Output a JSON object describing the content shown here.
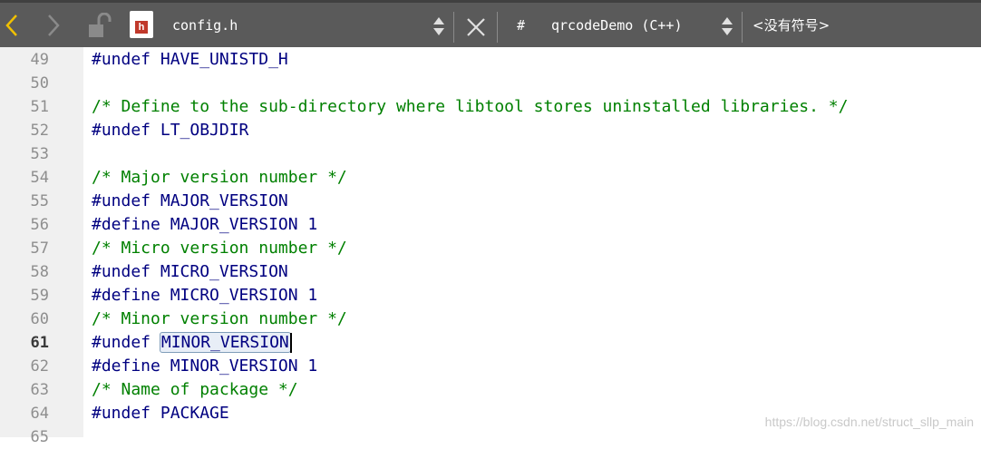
{
  "toolbar": {
    "file_name": "config.h",
    "hash_label": "#",
    "scope_name": "qrcodeDemo (C++)",
    "symbol_label": "<没有符号>",
    "icons": [
      "back-arrow-icon",
      "forward-arrow-icon",
      "unlock-icon",
      "header-file-icon",
      "updown-arrows-icon",
      "close-icon"
    ],
    "accent": "#f0c000"
  },
  "editor": {
    "current_line": "61",
    "lines": [
      {
        "no": "49",
        "kind": "directive",
        "text": "#undef HAVE_UNISTD_H"
      },
      {
        "no": "50",
        "kind": "blank",
        "text": ""
      },
      {
        "no": "51",
        "kind": "comment",
        "text": "/* Define to the sub-directory where libtool stores uninstalled libraries. */"
      },
      {
        "no": "52",
        "kind": "directive",
        "text": "#undef LT_OBJDIR"
      },
      {
        "no": "53",
        "kind": "blank",
        "text": ""
      },
      {
        "no": "54",
        "kind": "comment",
        "text": "/* Major version number */"
      },
      {
        "no": "55",
        "kind": "directive",
        "text": "#undef MAJOR_VERSION"
      },
      {
        "no": "56",
        "kind": "directive",
        "text": "#define MAJOR_VERSION 1"
      },
      {
        "no": "57",
        "kind": "comment",
        "text": "/* Micro version number */"
      },
      {
        "no": "58",
        "kind": "directive",
        "text": "#undef MICRO_VERSION"
      },
      {
        "no": "59",
        "kind": "directive",
        "text": "#define MICRO_VERSION 1"
      },
      {
        "no": "60",
        "kind": "comment",
        "text": "/* Minor version number */"
      },
      {
        "no": "61",
        "kind": "directive",
        "text": "#undef ",
        "highlight": "MINOR_VERSION"
      },
      {
        "no": "62",
        "kind": "directive",
        "text": "#define MINOR_VERSION 1"
      },
      {
        "no": "63",
        "kind": "comment",
        "text": "/* Name of package */"
      },
      {
        "no": "64",
        "kind": "directive",
        "text": "#undef PACKAGE"
      },
      {
        "no": "65",
        "kind": "blank",
        "text": ""
      }
    ]
  },
  "watermark": "https://blog.csdn.net/struct_sllp_main"
}
